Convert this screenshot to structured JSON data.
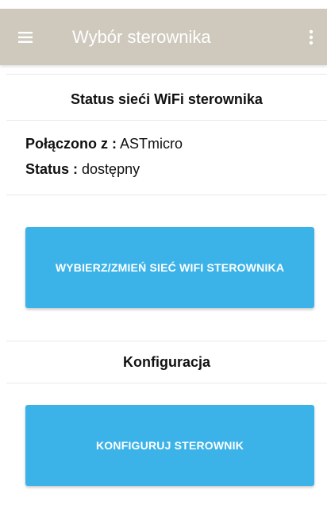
{
  "appbar": {
    "title": "Wybór sterownika",
    "menu_icon": "hamburger-menu-icon",
    "overflow_icon": "more-vert-icon",
    "background": "#cfc9bd"
  },
  "wifi_status": {
    "header": "Status sieći WiFi sterownika",
    "connected_label": "Połączono z :",
    "connected_value": "ASTmicro",
    "status_label": "Status :",
    "status_value": "dostępny"
  },
  "wifi_action": {
    "button_label": "WYBIERZ/ZMIEŃ SIEĆ WIFI STEROWNIKA"
  },
  "config": {
    "header": "Konfiguracja",
    "button_label": "KONFIGURUJ STEROWNIK"
  },
  "colors": {
    "button": "#3cb3e8",
    "text": "#111111"
  }
}
